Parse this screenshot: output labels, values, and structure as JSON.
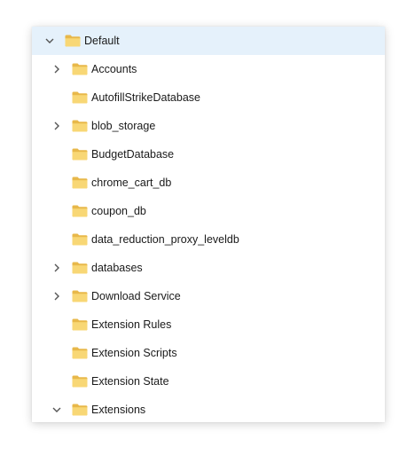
{
  "tree": {
    "root": {
      "label": "Default",
      "expanded": true,
      "expand_icon": "chevron-down-icon",
      "folder_icon": "folder-icon"
    },
    "children": [
      {
        "label": "Accounts",
        "has_children": true,
        "expanded": false
      },
      {
        "label": "AutofillStrikeDatabase",
        "has_children": false
      },
      {
        "label": "blob_storage",
        "has_children": true,
        "expanded": false
      },
      {
        "label": "BudgetDatabase",
        "has_children": false
      },
      {
        "label": "chrome_cart_db",
        "has_children": false
      },
      {
        "label": "coupon_db",
        "has_children": false
      },
      {
        "label": "data_reduction_proxy_leveldb",
        "has_children": false
      },
      {
        "label": "databases",
        "has_children": true,
        "expanded": false
      },
      {
        "label": "Download Service",
        "has_children": true,
        "expanded": false
      },
      {
        "label": "Extension Rules",
        "has_children": false
      },
      {
        "label": "Extension Scripts",
        "has_children": false
      },
      {
        "label": "Extension State",
        "has_children": false
      },
      {
        "label": "Extensions",
        "has_children": true,
        "expanded": true
      }
    ]
  },
  "colors": {
    "selected_row": "#e5f1fb",
    "folder_body": "#f8d775",
    "folder_tab": "#e8b84a",
    "chevron": "#555555",
    "text": "#1a1a1a"
  }
}
